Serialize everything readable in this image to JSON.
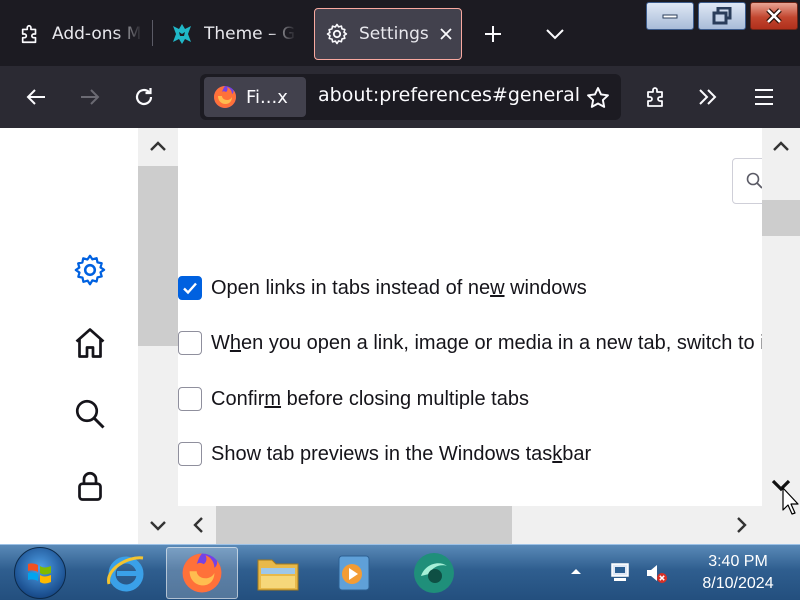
{
  "tabs": [
    {
      "label": "Add-ons Manager",
      "icon": "puzzle-icon"
    },
    {
      "label": "Theme – Get Add-ons",
      "icon": "theme-icon"
    },
    {
      "label": "Settings",
      "icon": "gear-icon",
      "active": true
    }
  ],
  "navbar": {
    "identity_label": "Fi...x",
    "url": "about:preferences#general"
  },
  "sidebar": {
    "items": [
      {
        "icon": "gear-icon",
        "selected": true
      },
      {
        "icon": "home-icon"
      },
      {
        "icon": "search-icon"
      },
      {
        "icon": "lock-icon"
      }
    ]
  },
  "options": [
    {
      "pre": "Open links in tabs instead of ne",
      "key": "w",
      "post": " windows",
      "checked": true
    },
    {
      "pre": "W",
      "key": "h",
      "post": "en you open a link, image or media in a new tab, switch to it immediately",
      "checked": false
    },
    {
      "pre": "Confir",
      "key": "m",
      "post": " before closing multiple tabs",
      "checked": false
    },
    {
      "pre": "Show tab previews in the Windows tas",
      "key": "k",
      "post": "bar",
      "checked": false
    }
  ],
  "taskbar": {
    "time": "3:40 PM",
    "date": "8/10/2024",
    "apps": [
      "internet-explorer-icon",
      "firefox-icon",
      "file-explorer-icon",
      "media-player-icon",
      "app-icon"
    ]
  },
  "colors": {
    "tabstrip": "#1c1b22",
    "navbar": "#2b2a33",
    "accent": "#0061e0",
    "active_tab_border": "#f9a9a0"
  }
}
